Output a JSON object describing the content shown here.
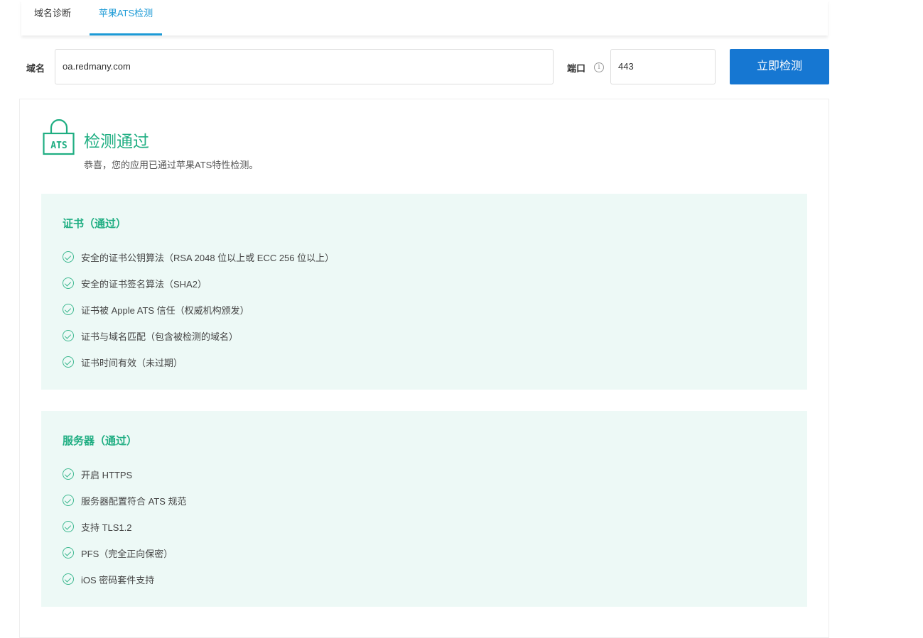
{
  "tabs": [
    {
      "label": "域名诊断"
    },
    {
      "label": "苹果ATS检测"
    }
  ],
  "form": {
    "domain_label": "域名",
    "domain_value": "oa.redmany.com",
    "port_label": "端口",
    "port_value": "443",
    "submit_label": "立即检测"
  },
  "result": {
    "icon_text": "ATS",
    "title": "检测通过",
    "subtitle": "恭喜，您的应用已通过苹果ATS特性检测。"
  },
  "sections": [
    {
      "header": "证书（通过）",
      "items": [
        "安全的证书公钥算法（RSA 2048 位以上或 ECC 256 位以上）",
        "安全的证书签名算法（SHA2）",
        "证书被 Apple ATS 信任（权威机构颁发）",
        "证书与域名匹配（包含被检测的域名）",
        "证书时间有效（未过期）"
      ]
    },
    {
      "header": "服务器（通过）",
      "items": [
        "开启 HTTPS",
        "服务器配置符合 ATS 规范",
        "支持 TLS1.2",
        "PFS（完全正向保密）",
        "iOS 密码套件支持"
      ]
    }
  ],
  "colors": {
    "accent": "#1fae82",
    "primary": "#1677d2",
    "tab_active": "#1c9ad6"
  }
}
